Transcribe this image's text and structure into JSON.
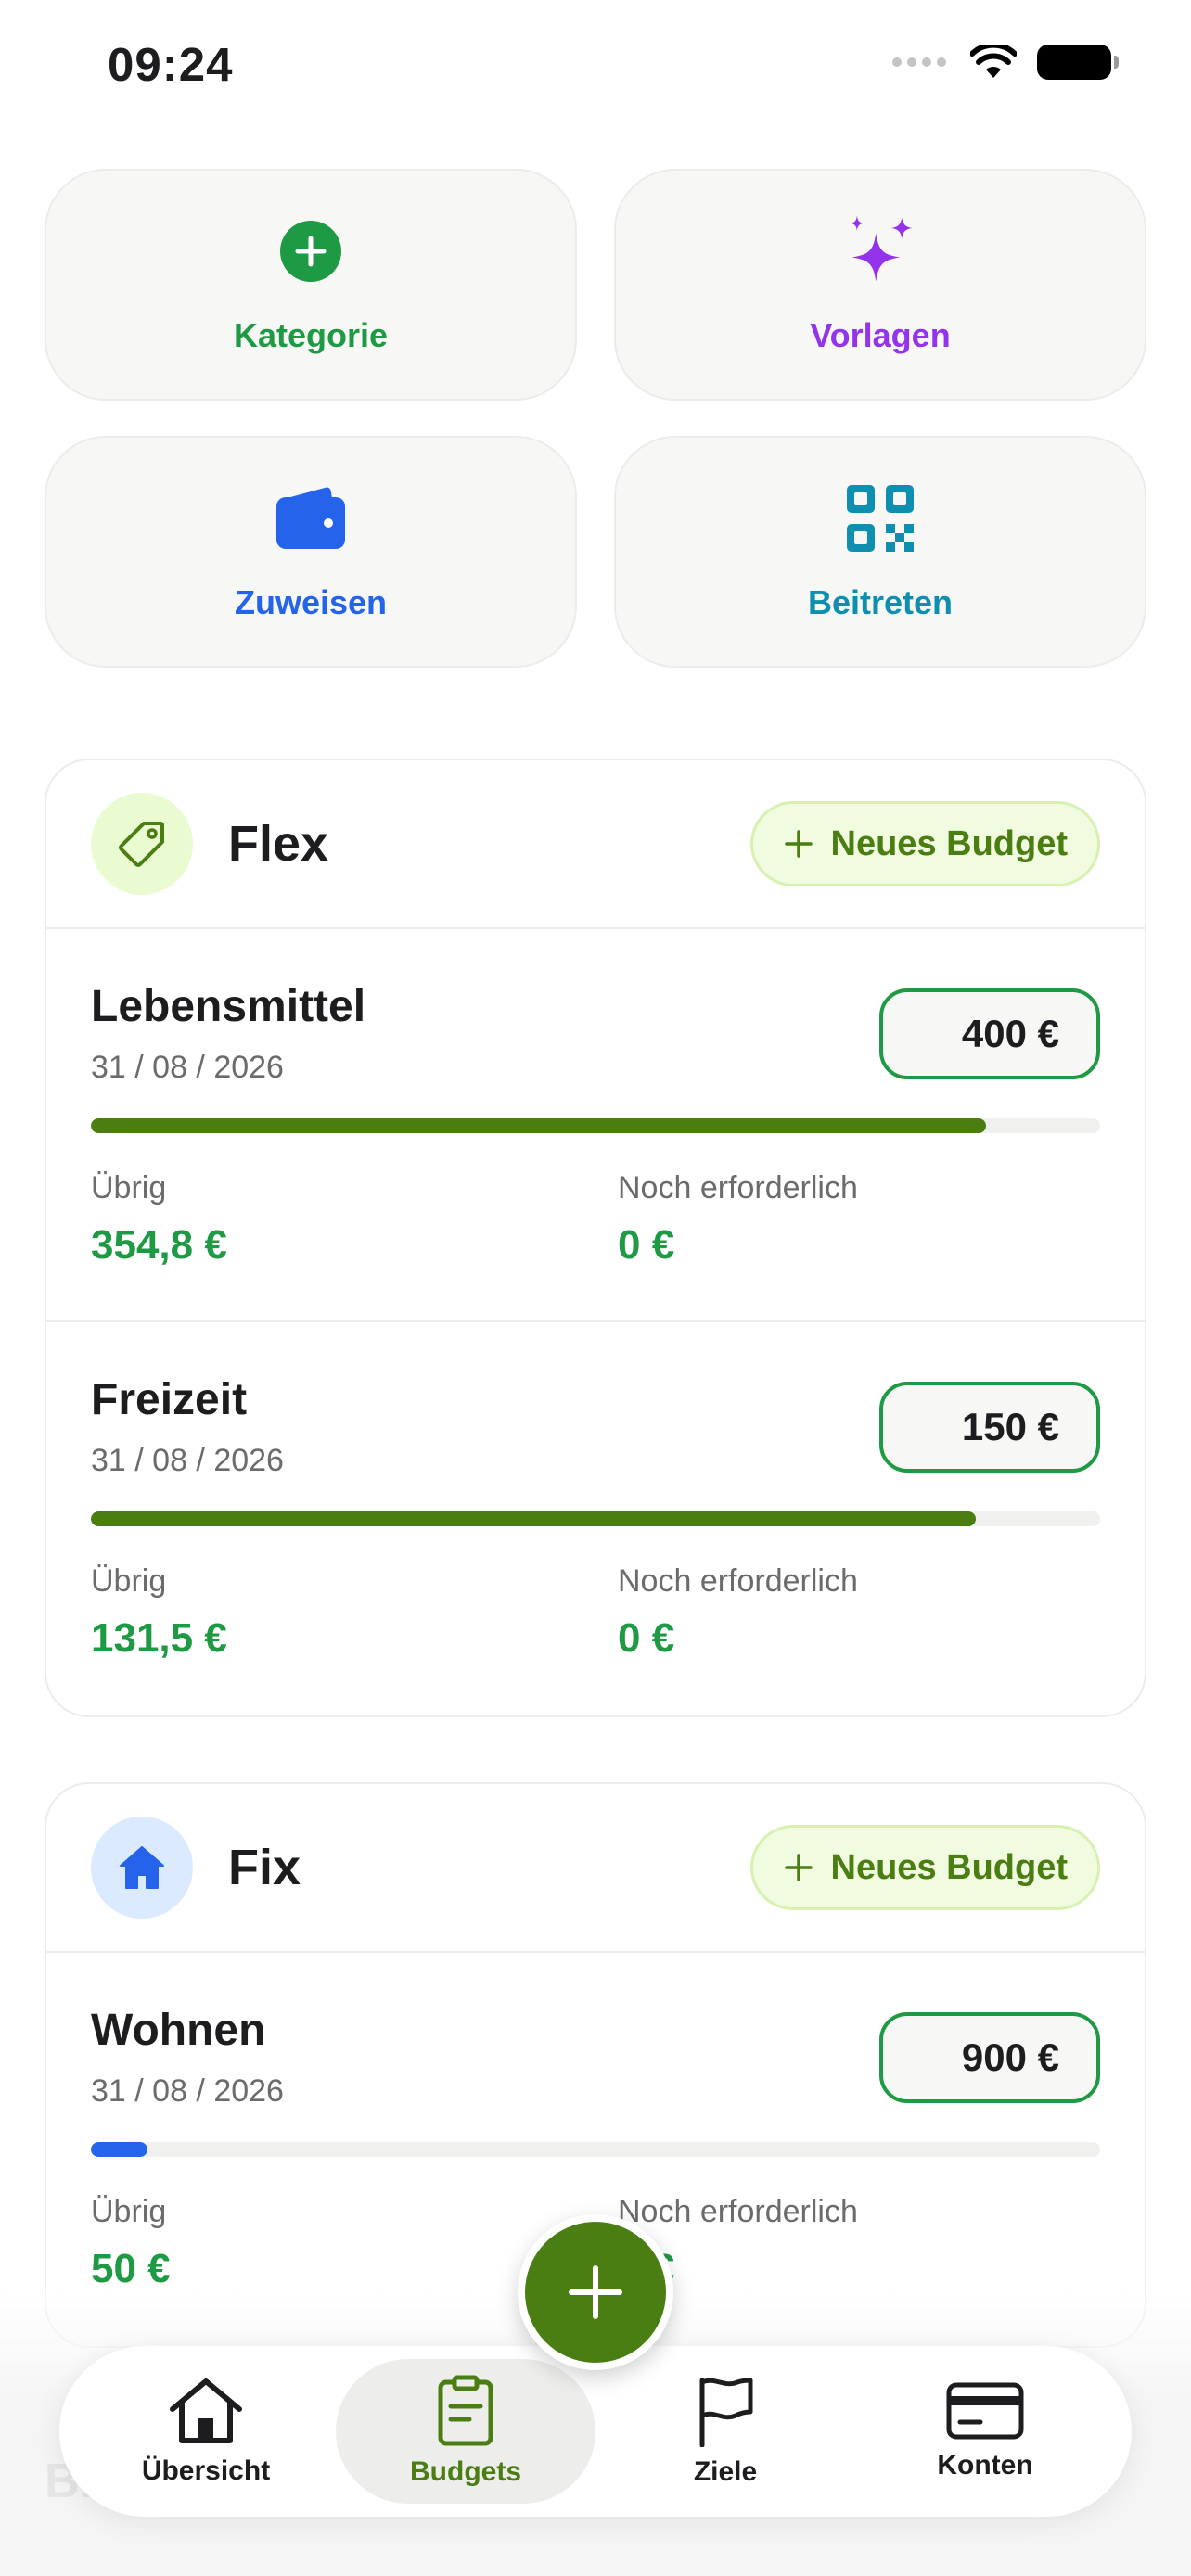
{
  "status_bar": {
    "time": "09:24"
  },
  "actions": [
    {
      "label": "Kategorie",
      "icon": "plus-circle-icon",
      "color": "#1e9a45"
    },
    {
      "label": "Vorlagen",
      "icon": "sparkles-icon",
      "color": "#9333ea"
    },
    {
      "label": "Zuweisen",
      "icon": "wallet-icon",
      "color": "#2563eb"
    },
    {
      "label": "Beitreten",
      "icon": "qr-code-icon",
      "color": "#0e8fb0"
    }
  ],
  "categories": [
    {
      "title": "Flex",
      "icon": "tag-icon",
      "new_budget_label": "Neues Budget",
      "budgets": [
        {
          "name": "Lebensmittel",
          "date": "31 / 08 / 2026",
          "amount": "400 €",
          "progress": 0.887,
          "remaining_label": "Übrig",
          "remaining": "354,8 €",
          "required_label": "Noch erforderlich",
          "required": "0 €"
        },
        {
          "name": "Freizeit",
          "date": "31 / 08 / 2026",
          "amount": "150 €",
          "progress": 0.877,
          "remaining_label": "Übrig",
          "remaining": "131,5 €",
          "required_label": "Noch erforderlich",
          "required": "0 €"
        }
      ]
    },
    {
      "title": "Fix",
      "icon": "house-icon",
      "new_budget_label": "Neues Budget",
      "budgets": [
        {
          "name": "Wohnen",
          "date": "31 / 08 / 2026",
          "amount": "900 €",
          "progress": 0.056,
          "remaining_label": "Übrig",
          "remaining": "50 €",
          "required_label": "Noch erforderlich",
          "required": "0 €"
        }
      ]
    }
  ],
  "colors": {
    "brand_green": "#4a7d12",
    "money_green": "#1e9a45",
    "progress_blue": "#2563eb"
  },
  "bottom_ghost_text": "B...",
  "tabs": [
    {
      "label": "Übersicht",
      "icon": "home-icon",
      "active": false
    },
    {
      "label": "Budgets",
      "icon": "clipboard-icon",
      "active": true
    },
    {
      "label": "Ziele",
      "icon": "flag-icon",
      "active": false
    },
    {
      "label": "Konten",
      "icon": "credit-card-icon",
      "active": false
    }
  ]
}
